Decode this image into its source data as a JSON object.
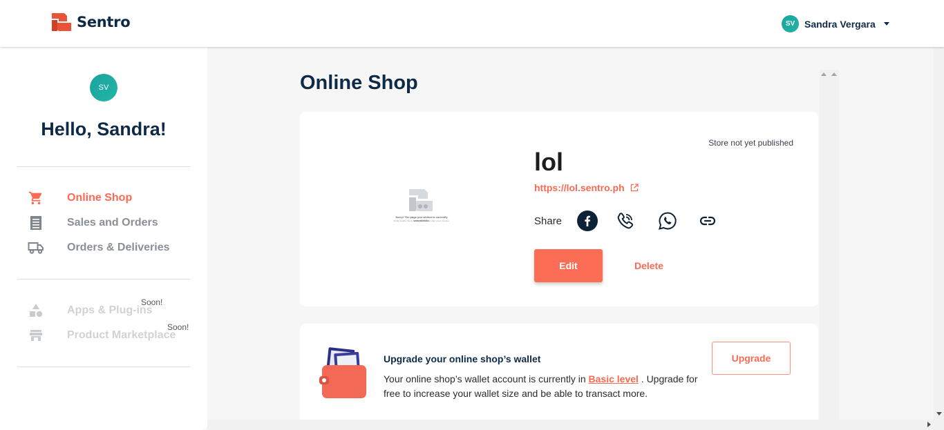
{
  "header": {
    "logo_text": "Sentro",
    "user_initials": "SV",
    "user_name": "Sandra Vergara"
  },
  "sidebar": {
    "avatar_initials": "SV",
    "greeting": "Hello, Sandra!",
    "items": [
      {
        "label": "Online Shop",
        "icon": "shopping-cart-icon",
        "state": "active"
      },
      {
        "label": "Sales and Orders",
        "icon": "receipt-icon",
        "state": "normal"
      },
      {
        "label": "Orders & Deliveries",
        "icon": "truck-icon",
        "state": "normal"
      },
      {
        "label": "Apps & Plug-ins",
        "icon": "shapes-icon",
        "state": "disabled",
        "badge": "Soon!"
      },
      {
        "label": "Product Marketplace",
        "icon": "storefront-icon",
        "state": "disabled",
        "badge": "Soon!"
      }
    ]
  },
  "main": {
    "title": "Online Shop",
    "store": {
      "status": "Store not yet published",
      "name": "lol",
      "url": "https://lol.sentro.ph",
      "share_label": "Share",
      "share_icons": [
        "facebook-icon",
        "viber-icon",
        "whatsapp-icon",
        "link-icon"
      ],
      "edit_label": "Edit",
      "delete_label": "Delete",
      "preview_text1": "Sorry! The page you visited is currently unavailable.",
      "preview_text2": "Kindly double check the link, or try again after a few minutes."
    },
    "wallet": {
      "title": "Upgrade your online shop’s wallet",
      "desc_before": "Your online shop’s wallet account is currently in ",
      "level": "Basic level",
      "desc_after": " . Upgrade for free to increase your wallet size and be able to transact more.",
      "upgrade_label": "Upgrade"
    }
  },
  "colors": {
    "accent": "#fa6a52",
    "navy": "#0e2a47",
    "teal": "#1aa39d"
  }
}
